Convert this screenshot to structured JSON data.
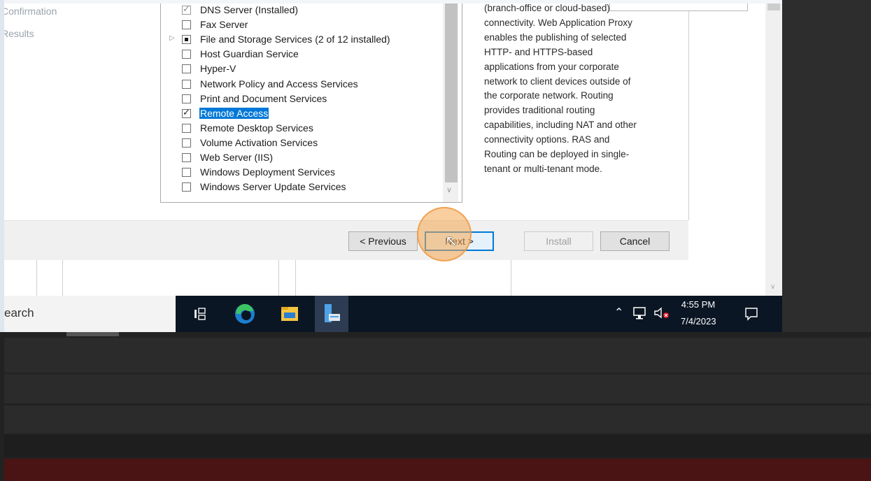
{
  "left_nav": {
    "items": [
      "Confirmation",
      "Results"
    ]
  },
  "roles": [
    {
      "label": "DNS Server (Installed)",
      "state": "checked-disabled",
      "expander": false
    },
    {
      "label": "Fax Server",
      "state": "unchecked",
      "expander": false
    },
    {
      "label": "File and Storage Services (2 of 12 installed)",
      "state": "partial",
      "expander": true
    },
    {
      "label": "Host Guardian Service",
      "state": "unchecked",
      "expander": false
    },
    {
      "label": "Hyper-V",
      "state": "unchecked",
      "expander": false
    },
    {
      "label": "Network Policy and Access Services",
      "state": "unchecked",
      "expander": false
    },
    {
      "label": "Print and Document Services",
      "state": "unchecked",
      "expander": false
    },
    {
      "label": "Remote Access",
      "state": "checked",
      "expander": false,
      "selected": true
    },
    {
      "label": "Remote Desktop Services",
      "state": "unchecked",
      "expander": false
    },
    {
      "label": "Volume Activation Services",
      "state": "unchecked",
      "expander": false
    },
    {
      "label": "Web Server (IIS)",
      "state": "unchecked",
      "expander": false
    },
    {
      "label": "Windows Deployment Services",
      "state": "unchecked",
      "expander": false
    },
    {
      "label": "Windows Server Update Services",
      "state": "unchecked",
      "expander": false
    }
  ],
  "description": {
    "lines": [
      "(branch-office or cloud-based)",
      "connectivity. Web Application Proxy",
      "enables the publishing of selected",
      "HTTP- and HTTPS-based",
      "applications from your corporate",
      "network to client devices outside of",
      "the corporate network. Routing",
      "provides traditional routing",
      "capabilities, including NAT and other",
      "connectivity options. RAS and",
      "Routing can be deployed in single-",
      "tenant or multi-tenant mode."
    ]
  },
  "buttons": {
    "previous": "< Previous",
    "next": "Next >",
    "install": "Install",
    "cancel": "Cancel"
  },
  "taskbar": {
    "search_text": "earch",
    "time": "4:55 PM",
    "date": "7/4/2023",
    "apps": [
      "task-view-icon",
      "edge-icon",
      "file-explorer-icon",
      "server-manager-icon"
    ],
    "tray": [
      "chevron-up-icon",
      "network-icon",
      "volume-muted-icon",
      "notification-icon"
    ]
  },
  "colors": {
    "selection": "#0078d7",
    "taskbar": "#0b1624",
    "click_highlight": "#f6a852",
    "bottom_band": "#4a1414"
  }
}
